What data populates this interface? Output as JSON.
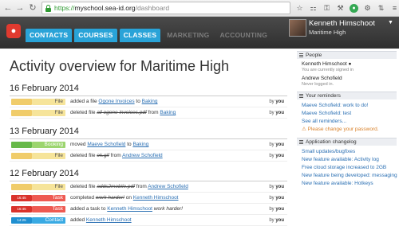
{
  "browser": {
    "url_scheme": "https://",
    "url_host": "myschool.sea-id.org",
    "url_path": "/dashboard",
    "icons": [
      "back-icon",
      "forward-icon",
      "reload-icon",
      "star-icon",
      "bookmark-icon",
      "key-icon",
      "wrench-icon",
      "evernote-icon",
      "puzzle-icon",
      "translate-icon",
      "menu-icon"
    ]
  },
  "header": {
    "tabs": [
      {
        "label": "CONTACTS",
        "active": true
      },
      {
        "label": "COURSES",
        "active": true
      },
      {
        "label": "CLASSES",
        "active": true
      },
      {
        "label": "MARKETING",
        "active": false
      },
      {
        "label": "ACCOUNTING",
        "active": false
      }
    ],
    "user_name": "Kenneth Himschoot",
    "user_school": "Maritime High"
  },
  "colors": {
    "accent": "#29a3d8",
    "file": "#f6e49a",
    "booking": "#9cd56f",
    "task": "#ee5a52",
    "contact": "#39aae3"
  },
  "main": {
    "title": "Activity overview for Maritime High",
    "days": [
      {
        "date": "16 February 2014",
        "rows": [
          {
            "kind": "file",
            "time": "",
            "badge": "File",
            "p1": "added a file ",
            "l1": "Ogone Invoices",
            "p2": " to ",
            "l2": "Baking",
            "p3": "",
            "by_prefix": "by",
            "by": "you"
          },
          {
            "kind": "file",
            "time": "",
            "badge": "File",
            "p1": "deleted file ",
            "s1": "all ogone invoices.pdf",
            "p2": " from ",
            "l2": "Baking",
            "p3": "",
            "by_prefix": "by",
            "by": "you"
          }
        ]
      },
      {
        "date": "13 February 2014",
        "rows": [
          {
            "kind": "booking",
            "time": "",
            "badge": "Booking",
            "p1": "moved ",
            "l1": "Maeve Schofield",
            "p2": " to ",
            "l2": "Baking",
            "p3": "",
            "by_prefix": "by",
            "by": "you"
          },
          {
            "kind": "file",
            "time": "",
            "badge": "File",
            "p1": "deleted file ",
            "s1": "ok.gif",
            "p2": " from ",
            "l2": "Andrew Schofield",
            "p3": "",
            "by_prefix": "by",
            "by": "you"
          }
        ]
      },
      {
        "date": "12 February 2014",
        "rows": [
          {
            "kind": "file",
            "time": "",
            "badge": "File",
            "p1": "deleted file ",
            "s1": "adds2mobile.pdf",
            "p2": " from ",
            "l2": "Andrew Schofield",
            "p3": "",
            "by_prefix": "by",
            "by": "you"
          },
          {
            "kind": "task",
            "time": "16:45",
            "badge": "Task",
            "p1": "completed ",
            "s1": "work harder!",
            "p2": " on ",
            "l2": "Kenneth Himschoot",
            "p3": "",
            "by_prefix": "by",
            "by": "you"
          },
          {
            "kind": "task",
            "time": "16:45",
            "badge": "Task",
            "p1": "added a task to ",
            "l1": "Kenneth Himschoot",
            "p2": " ",
            "i2": "work harder!",
            "p3": "",
            "by_prefix": "by",
            "by": "you"
          },
          {
            "kind": "contact",
            "time": "14:25",
            "badge": "Contact",
            "p1": "added ",
            "l1": "Kenneth Himschoot",
            "p2": "",
            "p3": "",
            "by_prefix": "by",
            "by": "you"
          }
        ]
      }
    ]
  },
  "sidebar": {
    "people": {
      "title": "People",
      "entries": [
        {
          "name": "Kenneth Himschoot",
          "sub": "You are currently signed in"
        },
        {
          "name": "Andrew Schofield",
          "sub": "Never logged in."
        }
      ]
    },
    "reminders": {
      "title": "Your reminders",
      "links": [
        "Maeve Schofield: work to do!",
        "Maeve Schofield: test",
        "See all reminders..."
      ],
      "warning": "Please change your password."
    },
    "changelog": {
      "title": "Application changelog",
      "links": [
        "Small updates/bugfixes",
        "New feature available: Activity log",
        "Free cloud storage increased to 2GB",
        "New feature being developed: messaging",
        "New feature available: Hotkeys"
      ]
    }
  }
}
